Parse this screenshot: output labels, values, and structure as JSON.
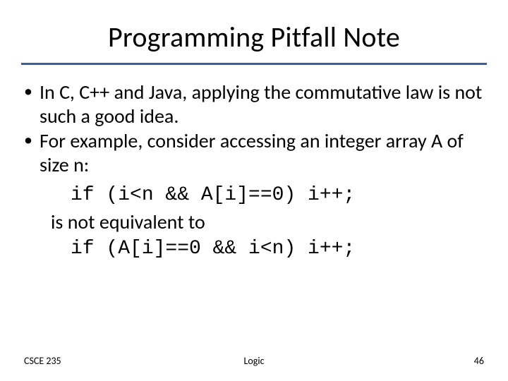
{
  "title": "Programming Pitfall Note",
  "bullets": [
    "In C, C++ and Java, applying the commutative law is not such a good idea.",
    "For example, consider accessing an integer array A of size n:"
  ],
  "example": {
    "code1": "if (i<n && A[i]==0) i++;",
    "note": "is not equivalent to",
    "code2": "if (A[i]==0 && i<n) i++;"
  },
  "footer": {
    "left": "CSCE 235",
    "center": "Logic",
    "right": "46"
  }
}
